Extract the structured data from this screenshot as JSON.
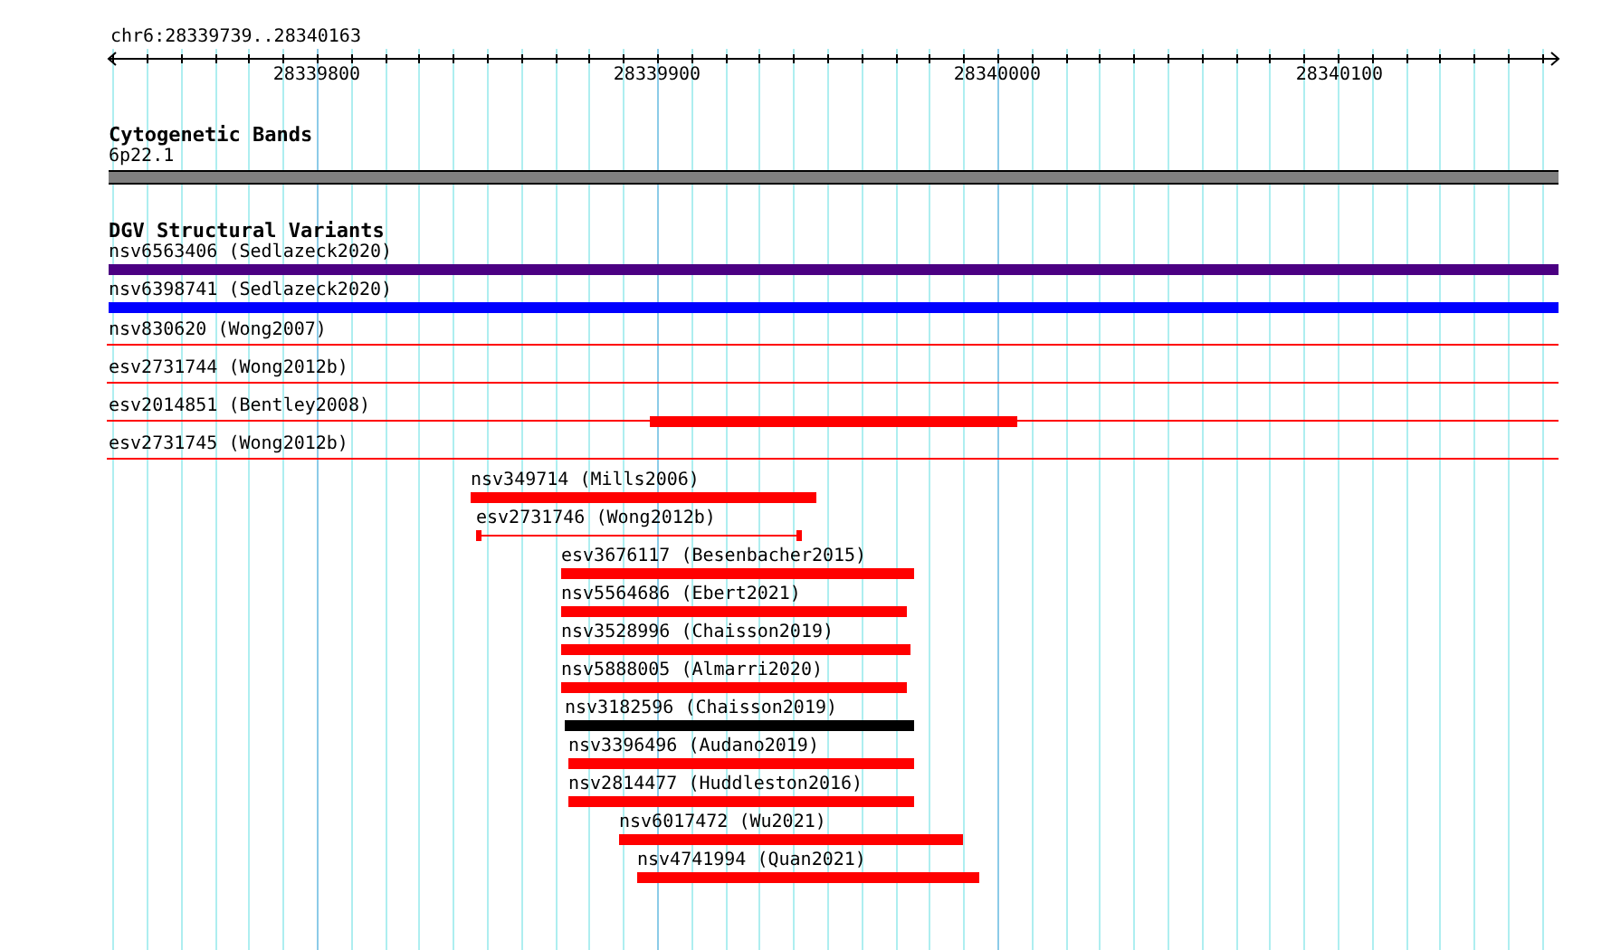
{
  "locus": "chr6:28339739..28340163",
  "ruler": {
    "ticks": [
      "28339800",
      "28339900",
      "28340000",
      "28340100"
    ]
  },
  "tracks": [
    {
      "title": "Cytogenetic Bands",
      "features": [
        {
          "label": "6p22.1",
          "kind": "band",
          "color": "#808080"
        }
      ]
    },
    {
      "title": "DGV Structural Variants",
      "features": [
        {
          "label": "nsv6563406 (Sedlazeck2020)",
          "kind": "bar",
          "color": "#4b0082"
        },
        {
          "label": "nsv6398741 (Sedlazeck2020)",
          "kind": "bar",
          "color": "#0000ff"
        },
        {
          "label": "nsv830620 (Wong2007)",
          "kind": "line",
          "color": "#ff0000"
        },
        {
          "label": "esv2731744 (Wong2012b)",
          "kind": "line",
          "color": "#ff0000"
        },
        {
          "label": "esv2014851 (Bentley2008)",
          "kind": "line",
          "color": "#ff0000"
        },
        {
          "label": "esv2731745 (Wong2012b)",
          "kind": "line",
          "color": "#ff0000"
        },
        {
          "label": "nsv349714 (Mills2006)",
          "kind": "bar",
          "color": "#ff0000"
        },
        {
          "label": "esv2731746 (Wong2012b)",
          "kind": "interval",
          "color": "#ff0000"
        },
        {
          "label": "esv3676117 (Besenbacher2015)",
          "kind": "bar",
          "color": "#ff0000"
        },
        {
          "label": "nsv5564686 (Ebert2021)",
          "kind": "bar",
          "color": "#ff0000"
        },
        {
          "label": "nsv3528996 (Chaisson2019)",
          "kind": "bar",
          "color": "#ff0000"
        },
        {
          "label": "nsv5888005 (Almarri2020)",
          "kind": "bar",
          "color": "#ff0000"
        },
        {
          "label": "nsv3182596 (Chaisson2019)",
          "kind": "bar",
          "color": "#000000"
        },
        {
          "label": "nsv3396496 (Audano2019)",
          "kind": "bar",
          "color": "#ff0000"
        },
        {
          "label": "nsv2814477 (Huddleston2016)",
          "kind": "bar",
          "color": "#ff0000"
        },
        {
          "label": "nsv6017472 (Wu2021)",
          "kind": "bar",
          "color": "#ff0000"
        },
        {
          "label": "nsv4741994 (Quan2021)",
          "kind": "bar",
          "color": "#ff0000"
        }
      ]
    }
  ]
}
